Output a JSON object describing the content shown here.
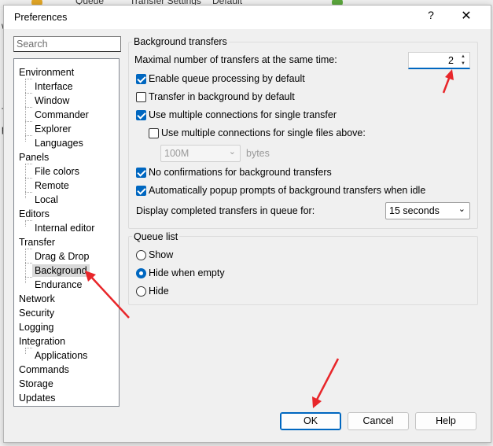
{
  "background": {
    "toolbar_queue": "Queue",
    "toolbar_transfer_settings": "Transfer Settings",
    "toolbar_default": "Default",
    "left_letters": [
      "w",
      "T",
      "p"
    ],
    "right_text": "ory"
  },
  "dialog": {
    "title": "Preferences",
    "help_glyph": "?",
    "close_glyph": "✕"
  },
  "search": {
    "placeholder": "Search"
  },
  "tree": {
    "environment": "Environment",
    "interface": "Interface",
    "window": "Window",
    "commander": "Commander",
    "explorer": "Explorer",
    "languages": "Languages",
    "panels": "Panels",
    "file_colors": "File colors",
    "remote": "Remote",
    "local": "Local",
    "editors": "Editors",
    "internal_editor": "Internal editor",
    "transfer": "Transfer",
    "drag_drop": "Drag & Drop",
    "background": "Background",
    "endurance": "Endurance",
    "network": "Network",
    "security": "Security",
    "logging": "Logging",
    "integration": "Integration",
    "applications": "Applications",
    "commands": "Commands",
    "storage": "Storage",
    "updates": "Updates"
  },
  "background_transfers": {
    "group_title": "Background transfers",
    "max_transfers_label": "Maximal number of transfers at the same time:",
    "max_transfers_value": "2",
    "enable_queue_processing": "Enable queue processing by default",
    "transfer_in_background": "Transfer in background by default",
    "multiple_connections": "Use multiple connections for single transfer",
    "multiple_connections_above": "Use multiple connections for single files above:",
    "size_value": "100M",
    "size_unit": "bytes",
    "no_confirmations": "No confirmations for background transfers",
    "auto_popup_prompts": "Automatically popup prompts of background transfers when idle",
    "display_completed_label": "Display completed transfers in queue for:",
    "display_completed_value": "15 seconds",
    "checked": {
      "enable_queue_processing": true,
      "transfer_in_background": false,
      "multiple_connections": true,
      "multiple_connections_above": false,
      "no_confirmations": true,
      "auto_popup_prompts": true
    }
  },
  "queue_list": {
    "group_title": "Queue list",
    "show": "Show",
    "hide_when_empty": "Hide when empty",
    "hide": "Hide",
    "selected": "hide_when_empty"
  },
  "buttons": {
    "ok": "OK",
    "cancel": "Cancel",
    "help": "Help"
  },
  "colors": {
    "accent": "#0067c0",
    "annotation_arrow": "#e8262a",
    "selection": "#d9d9d9"
  },
  "icons": {
    "spin_up": "▲",
    "spin_down": "▼",
    "combo_arrow": "⌄"
  }
}
